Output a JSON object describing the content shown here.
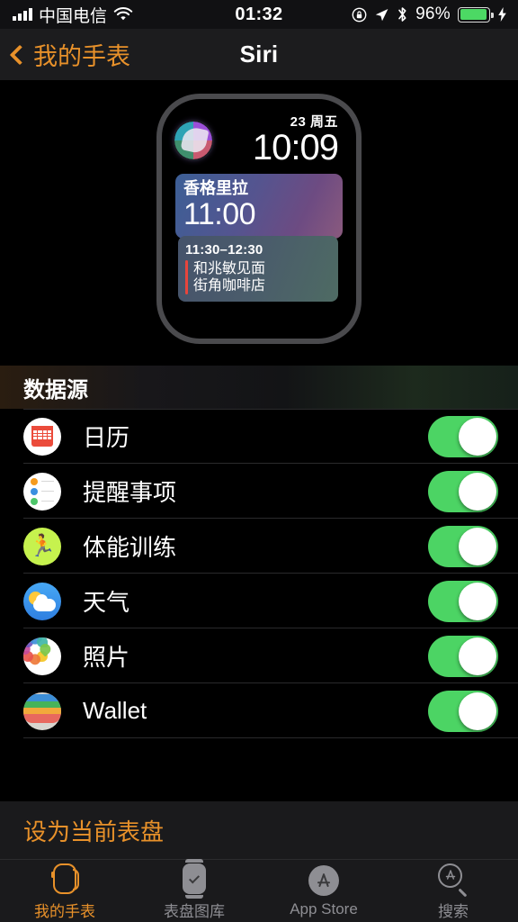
{
  "status_bar": {
    "signal_icon": "signal-bars-icon",
    "carrier": "中国电信",
    "wifi_icon": "wifi-icon",
    "time": "01:32",
    "rotation_lock_icon": "rotation-lock-icon",
    "location_icon": "location-arrow-icon",
    "bluetooth_icon": "bluetooth-icon",
    "battery_percent": "96%",
    "battery_icon": "battery-icon",
    "charging_icon": "lightning-bolt-icon"
  },
  "nav": {
    "back_icon": "chevron-left-icon",
    "back_label": "我的手表",
    "title": "Siri"
  },
  "watch_preview": {
    "siri_icon": "siri-orb-icon",
    "date": "23 周五",
    "time": "10:09",
    "card_calendar": {
      "title": "香格里拉",
      "time": "11:00"
    },
    "card_event": {
      "range": "11:30–12:30",
      "line1": "和兆敏见面",
      "line2": "街角咖啡店",
      "accent_color": "#E8453C"
    }
  },
  "section": {
    "header": "数据源"
  },
  "data_sources": [
    {
      "label": "日历",
      "icon": "calendar-icon",
      "enabled": true
    },
    {
      "label": "提醒事项",
      "icon": "reminders-icon",
      "enabled": true
    },
    {
      "label": "体能训练",
      "icon": "workout-icon",
      "enabled": true
    },
    {
      "label": "天气",
      "icon": "weather-icon",
      "enabled": true
    },
    {
      "label": "照片",
      "icon": "photos-icon",
      "enabled": true
    },
    {
      "label": "Wallet",
      "icon": "wallet-icon",
      "enabled": true
    }
  ],
  "action": {
    "label": "设为当前表盘",
    "color": "#E8912A"
  },
  "tabs": [
    {
      "label": "我的手表",
      "icon": "watch-icon",
      "active": true
    },
    {
      "label": "表盘图库",
      "icon": "face-gallery-icon",
      "active": false
    },
    {
      "label": "App Store",
      "icon": "app-store-icon",
      "active": false
    },
    {
      "label": "搜索",
      "icon": "search-icon",
      "active": false
    }
  ],
  "colors": {
    "accent": "#E8912A",
    "toggle_on": "#4CD464",
    "background": "#000000"
  }
}
